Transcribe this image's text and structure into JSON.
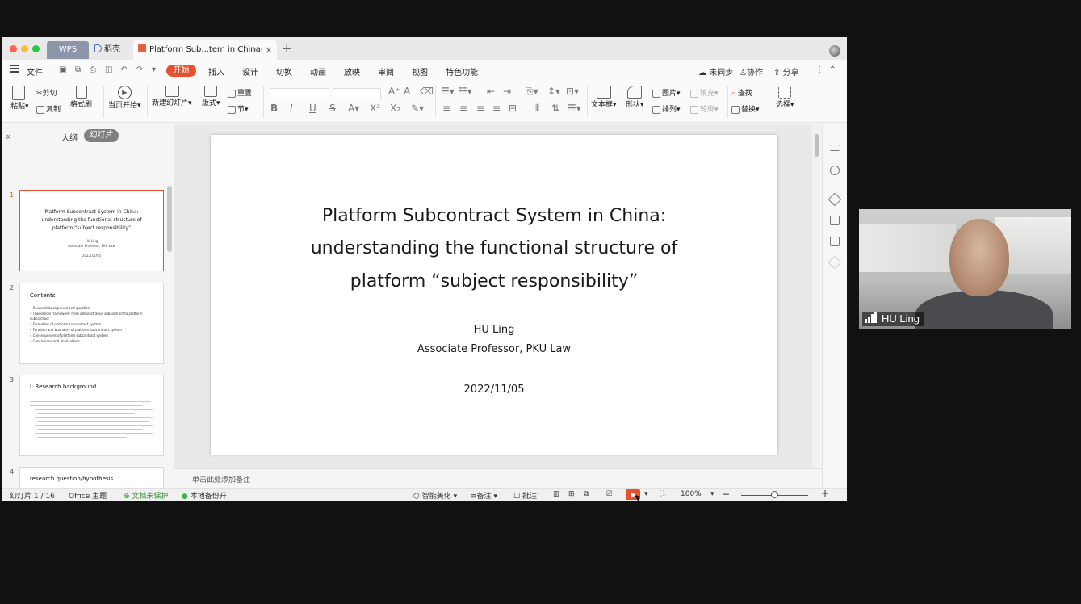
{
  "tabs": {
    "wps": "WPS",
    "daoke": "稻壳",
    "doc": "Platform Sub...tem in China"
  },
  "menu": {
    "file": "文件",
    "items": [
      "开始",
      "插入",
      "设计",
      "切换",
      "动画",
      "放映",
      "审阅",
      "视图",
      "特色功能"
    ],
    "right": {
      "sync": "未同步",
      "collab": "协作",
      "share": "分享"
    }
  },
  "ribbon": {
    "paste": "粘贴",
    "cut": "剪切",
    "copy": "复制",
    "format_painter": "格式刷",
    "play_from_current": "当页开始",
    "new_slide": "新建幻灯片",
    "layout": "版式",
    "section": "节",
    "reset": "重置",
    "textbox": "文本框",
    "shape": "形状",
    "picture": "图片",
    "arrange": "排列",
    "fill": "填充",
    "outline": "轮廓",
    "find": "查找",
    "replace": "替换",
    "select": "选择"
  },
  "left_panel": {
    "tab_outline": "大纲",
    "tab_slides": "幻灯片",
    "thumbs": [
      {
        "num": "1",
        "title_lines": [
          "Platform Subcontract System in China:",
          "understanding the functional structure of",
          "platform “subject responsibility”"
        ],
        "small_lines": [
          "HU Ling",
          "Associate Professor, PKU Law",
          "2022/11/05"
        ]
      },
      {
        "num": "2",
        "heading": "Contents",
        "bullets": [
          "• Research background and question",
          "• Theoretical framework: from administrative subcontract to platform",
          "   subcontract",
          "• Formation of platform subcontract system",
          "• Function and boundary of platform subcontract system",
          "• Consequences of platform subcontract system",
          "• Conclusions and implications"
        ]
      },
      {
        "num": "3",
        "heading": "I. Research background"
      },
      {
        "num": "4",
        "heading": "research question/hypothesis"
      }
    ]
  },
  "slide": {
    "title_lines": [
      "Platform Subcontract System in China:",
      "understanding the functional structure of",
      "platform “subject responsibility”"
    ],
    "author": "HU Ling",
    "affiliation": "Associate Professor, PKU Law",
    "date": "2022/11/05"
  },
  "notes_placeholder": "单击此处添加备注",
  "status": {
    "slide_counter": "幻灯片 1 / 16",
    "theme": "Office 主题",
    "doc_protect": "文档未保护",
    "local_backup": "本地备份开",
    "beautify": "智能美化",
    "notes": "备注",
    "comments": "批注",
    "zoom": "100%"
  },
  "video": {
    "participant": "HU Ling"
  },
  "colors": {
    "accent": "#e8512f",
    "wps_tab": "#8d96a8"
  }
}
